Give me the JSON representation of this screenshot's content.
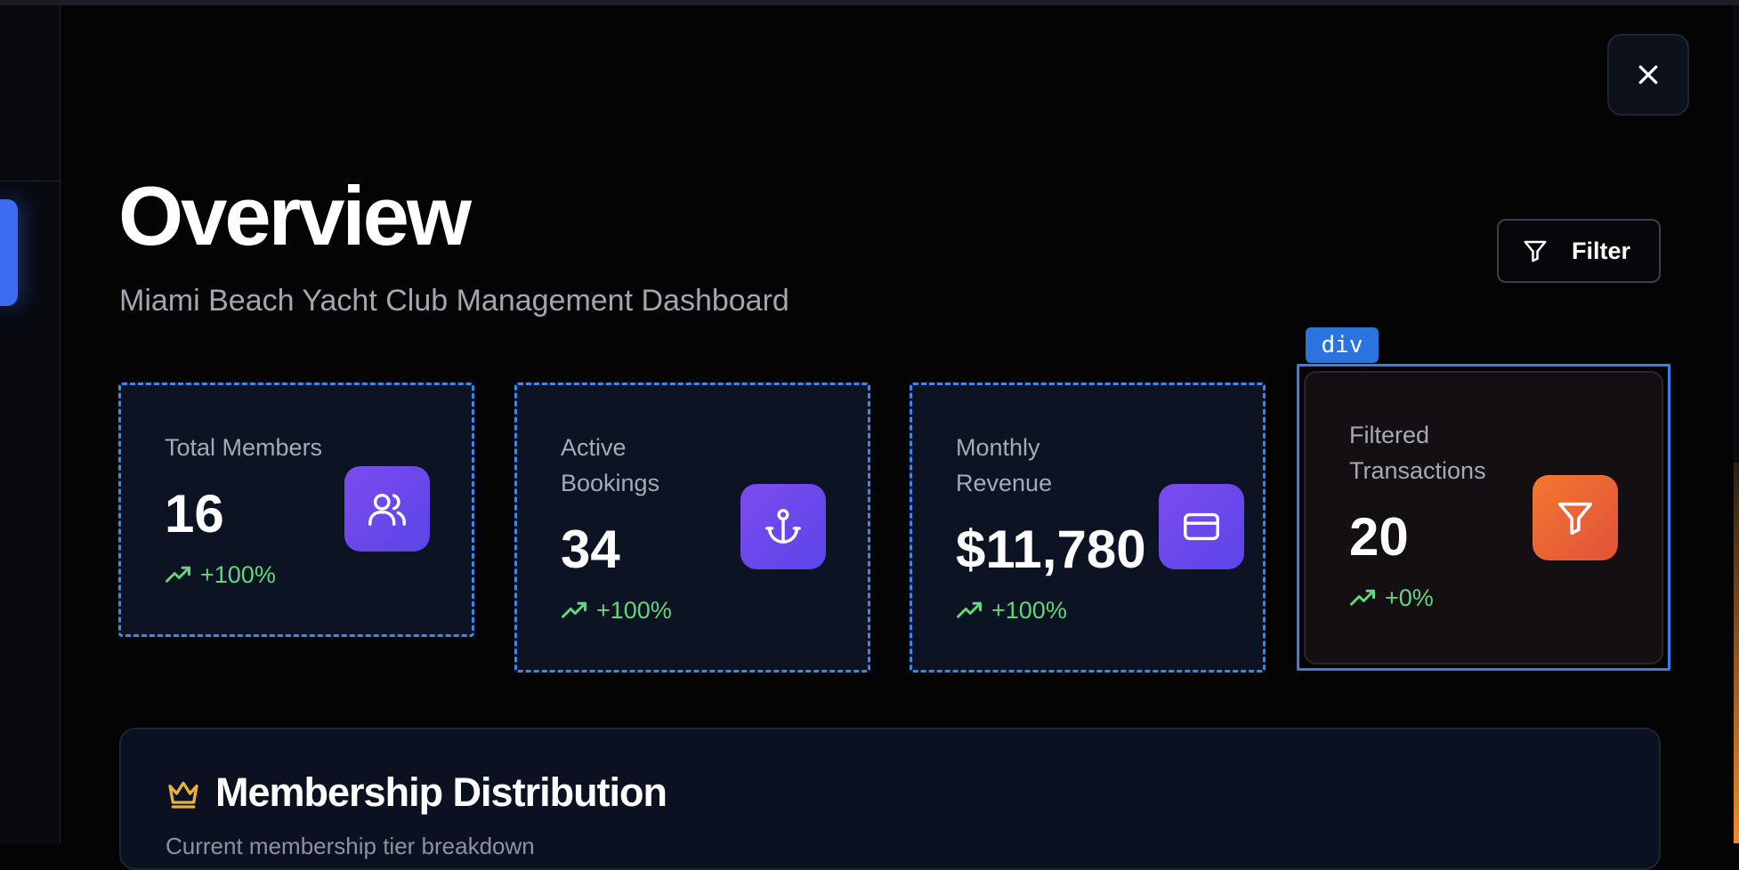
{
  "header": {
    "title": "Overview",
    "subtitle": "Miami Beach Yacht Club Management Dashboard",
    "filter_label": "Filter"
  },
  "inspector": {
    "tag": "div"
  },
  "stats": [
    {
      "label": "Total Members",
      "value": "16",
      "trend": "+100%",
      "icon": "users-icon"
    },
    {
      "label": "Active Bookings",
      "value": "34",
      "trend": "+100%",
      "icon": "anchor-icon"
    },
    {
      "label": "Monthly Revenue",
      "value": "$11,780",
      "trend": "+100%",
      "icon": "credit-card-icon"
    },
    {
      "label": "Filtered Transactions",
      "value": "20",
      "trend": "+0%",
      "icon": "filter-icon"
    }
  ],
  "panel": {
    "title": "Membership Distribution",
    "subtitle": "Current membership tier breakdown",
    "icon": "crown-icon"
  },
  "colors": {
    "accent_purple": "#6a48ec",
    "accent_orange": "#ef6a33",
    "trend_green": "#63d67d",
    "crown_gold": "#e8b23a",
    "highlight_blue": "#3f86ee"
  }
}
